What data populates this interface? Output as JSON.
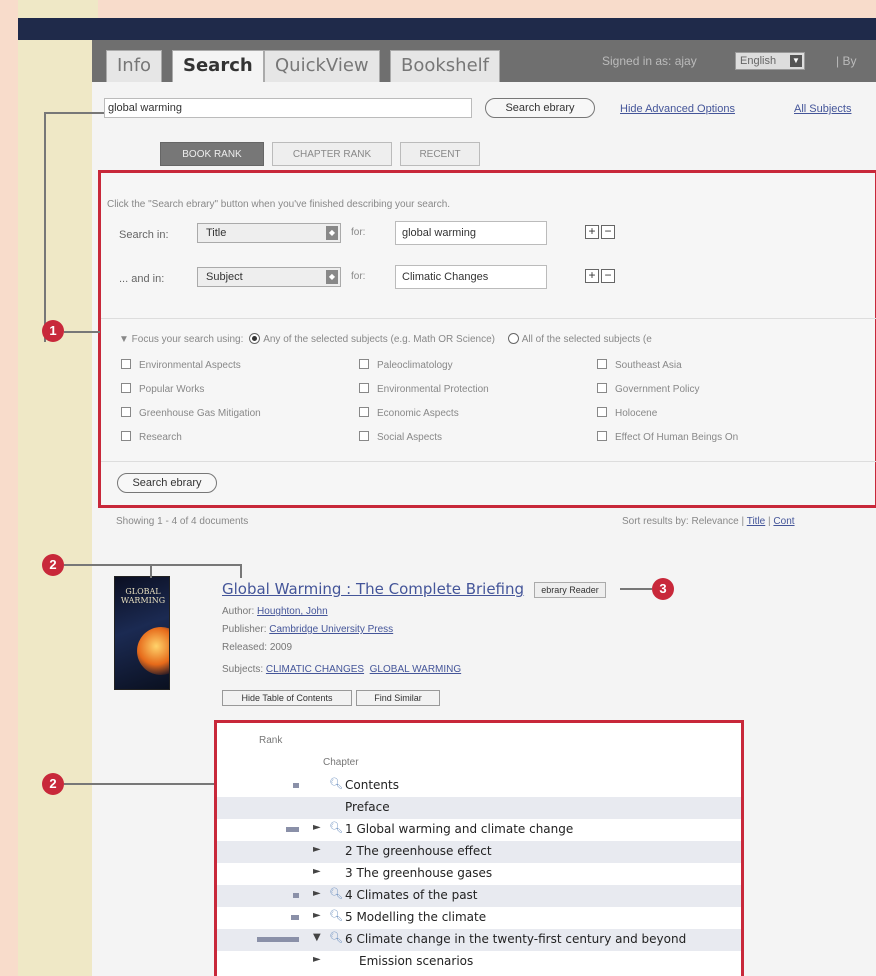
{
  "tabs": [
    {
      "label": "Info",
      "active": false
    },
    {
      "label": "Search",
      "active": true
    },
    {
      "label": "QuickView",
      "active": false
    },
    {
      "label": "Bookshelf",
      "active": false
    }
  ],
  "header": {
    "signed_in": "Signed in as: ajay",
    "language": "English",
    "by": "| By"
  },
  "search": {
    "query": "global warming",
    "button_label": "Search ebrary",
    "hide_advanced": "Hide Advanced Options",
    "all_subjects": "All Subjects"
  },
  "rank_tabs": [
    "BOOK RANK",
    "CHAPTER RANK",
    "RECENT"
  ],
  "advanced": {
    "instruction": "Click the \"Search ebrary\" button when you've finished describing your search.",
    "row1": {
      "label": "Search in:",
      "field": "Title",
      "for": "for:",
      "value": "global warming"
    },
    "row2": {
      "label": "... and in:",
      "field": "Subject",
      "for": "for:",
      "value": "Climatic Changes"
    },
    "plus": "+",
    "minus": "−",
    "focus_prefix": "▼ Focus your search using:",
    "focus_any": "Any of the selected subjects (e.g. Math OR Science)",
    "focus_all": "All of the selected subjects (e",
    "subjects": [
      "Environmental Aspects",
      "Paleoclimatology",
      "Southeast Asia",
      "Popular Works",
      "Environmental Protection",
      "Government Policy",
      "Greenhouse Gas Mitigation",
      "Economic Aspects",
      "Holocene",
      "Research",
      "Social Aspects",
      "Effect Of Human Beings On"
    ],
    "button_label": "Search ebrary"
  },
  "results": {
    "showing": "Showing 1 - 4 of 4 documents",
    "sort_prefix": "Sort results by: Relevance |",
    "sort_title": "Title",
    "sort_sep": "|",
    "sort_contrib": "Cont"
  },
  "book": {
    "cover_text": "GLOBAL WARMING",
    "title": "Global Warming : The Complete Briefing",
    "reader_button": "ebrary Reader",
    "author_label": "Author:",
    "author": "Houghton, John",
    "publisher_label": "Publisher:",
    "publisher": "Cambridge University Press",
    "released_label": "Released:",
    "released": "2009",
    "subjects_label": "Subjects:",
    "subject1": "CLIMATIC CHANGES",
    "subject2": "GLOBAL WARMING",
    "hide_toc": "Hide Table of Contents",
    "find_similar": "Find Similar"
  },
  "toc": {
    "rank_header": "Rank",
    "chapter_header": "Chapter",
    "rows": [
      {
        "text": "Contents",
        "rank": 0.1,
        "arrow": "",
        "mag": true,
        "shaded": false
      },
      {
        "text": "Preface",
        "rank": 0,
        "arrow": "",
        "mag": false,
        "shaded": true
      },
      {
        "text": "1 Global warming and climate change",
        "rank": 0.3,
        "arrow": "►",
        "mag": true,
        "shaded": false
      },
      {
        "text": "2 The greenhouse effect",
        "rank": 0,
        "arrow": "►",
        "mag": false,
        "shaded": true
      },
      {
        "text": "3 The greenhouse gases",
        "rank": 0,
        "arrow": "►",
        "mag": false,
        "shaded": false
      },
      {
        "text": "4 Climates of the past",
        "rank": 0.1,
        "arrow": "►",
        "mag": true,
        "shaded": true
      },
      {
        "text": "5 Modelling the climate",
        "rank": 0.2,
        "arrow": "►",
        "mag": true,
        "shaded": false
      },
      {
        "text": "6 Climate change in the twenty-first century and beyond",
        "rank": 1.0,
        "arrow": "▼",
        "mag": true,
        "shaded": true
      },
      {
        "text": "Emission scenarios",
        "rank": 0,
        "arrow": "►",
        "mag": false,
        "shaded": false
      }
    ]
  },
  "callouts": {
    "one": "1",
    "two": "2",
    "three": "3"
  }
}
